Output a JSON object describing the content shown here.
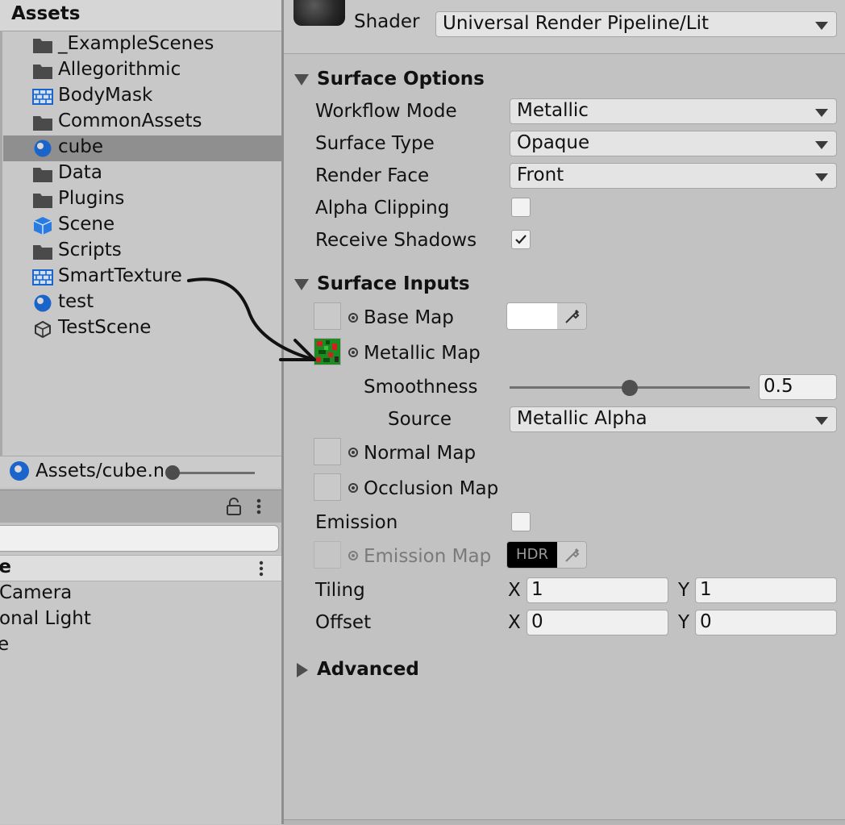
{
  "project": {
    "title": "Assets",
    "items": [
      {
        "label": "_ExampleScenes",
        "icon": "folder-icon"
      },
      {
        "label": "Allegorithmic",
        "icon": "folder-icon"
      },
      {
        "label": "BodyMask",
        "icon": "texture-icon"
      },
      {
        "label": "CommonAssets",
        "icon": "folder-icon"
      },
      {
        "label": "cube",
        "icon": "material-icon",
        "selected": true
      },
      {
        "label": "Data",
        "icon": "folder-icon"
      },
      {
        "label": "Plugins",
        "icon": "folder-icon"
      },
      {
        "label": "Scene",
        "icon": "prefab-cube-icon"
      },
      {
        "label": "Scripts",
        "icon": "folder-icon"
      },
      {
        "label": "SmartTexture",
        "icon": "texture-icon"
      },
      {
        "label": "test",
        "icon": "material-icon"
      },
      {
        "label": "TestScene",
        "icon": "unity-scene-icon"
      }
    ],
    "path": "Assets/cube.mat"
  },
  "hierarchy": {
    "search_placeholder": "",
    "scene_name": "ne",
    "items": [
      "Camera",
      "onal Light",
      "e"
    ]
  },
  "inspector": {
    "shader_label": "Shader",
    "shader_value": "Universal Render Pipeline/Lit",
    "surface_options": {
      "title": "Surface Options",
      "workflow_mode_label": "Workflow Mode",
      "workflow_mode_value": "Metallic",
      "surface_type_label": "Surface Type",
      "surface_type_value": "Opaque",
      "render_face_label": "Render Face",
      "render_face_value": "Front",
      "alpha_clipping_label": "Alpha Clipping",
      "alpha_clipping_checked": false,
      "receive_shadows_label": "Receive Shadows",
      "receive_shadows_checked": true
    },
    "surface_inputs": {
      "title": "Surface Inputs",
      "base_map_label": "Base Map",
      "metallic_map_label": "Metallic Map",
      "smoothness_label": "Smoothness",
      "smoothness_value": "0.5",
      "source_label": "Source",
      "source_value": "Metallic Alpha",
      "normal_map_label": "Normal Map",
      "occlusion_map_label": "Occlusion Map",
      "emission_label": "Emission",
      "emission_checked": false,
      "emission_map_label": "Emission Map",
      "hdr_label": "HDR",
      "tiling_label": "Tiling",
      "offset_label": "Offset",
      "axis_x": "X",
      "axis_y": "Y",
      "tiling_x": "1",
      "tiling_y": "1",
      "offset_x": "0",
      "offset_y": "0"
    },
    "advanced": {
      "title": "Advanced"
    }
  },
  "colors": {
    "accent_blue": "#1b64c9",
    "selection": "#8f8f8f",
    "metallic_thumb_green": "#1c7a1c",
    "metallic_thumb_red": "#d22020"
  }
}
